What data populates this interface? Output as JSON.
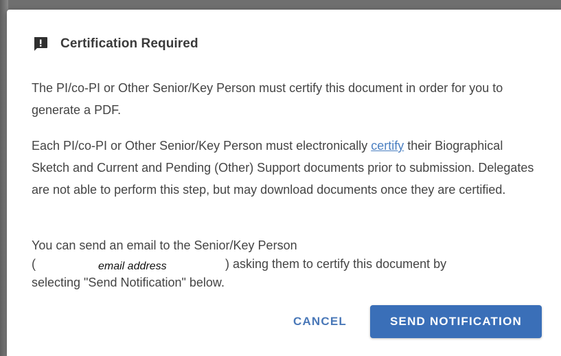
{
  "dialog": {
    "icon": "alert-feedback-icon",
    "title": "Certification Required",
    "paragraph1": "The PI/co-PI or Other Senior/Key Person must certify this document in order for you to generate a PDF.",
    "paragraph2": {
      "before_link": "Each PI/co-PI or Other Senior/Key Person must electronically ",
      "link_text": "certify",
      "after_link": " their Biographical Sketch and Current and Pending (Other) Support documents prior to submission. Delegates are not able to perform this step, but may download documents once they are certified."
    },
    "paragraph3": {
      "line1": "You can send an email to the Senior/Key Person",
      "open_paren": "(",
      "email_placeholder": "email address",
      "after_email": ") asking them to certify this document by",
      "line3": "selecting \"Send Notification\" below."
    },
    "cancel_label": "CANCEL",
    "send_label": "SEND NOTIFICATION"
  },
  "colors": {
    "link": "#4a7fc1",
    "primary_button": "#3a6fb8",
    "cancel_text": "#4a78b8",
    "body_text": "#444444"
  }
}
